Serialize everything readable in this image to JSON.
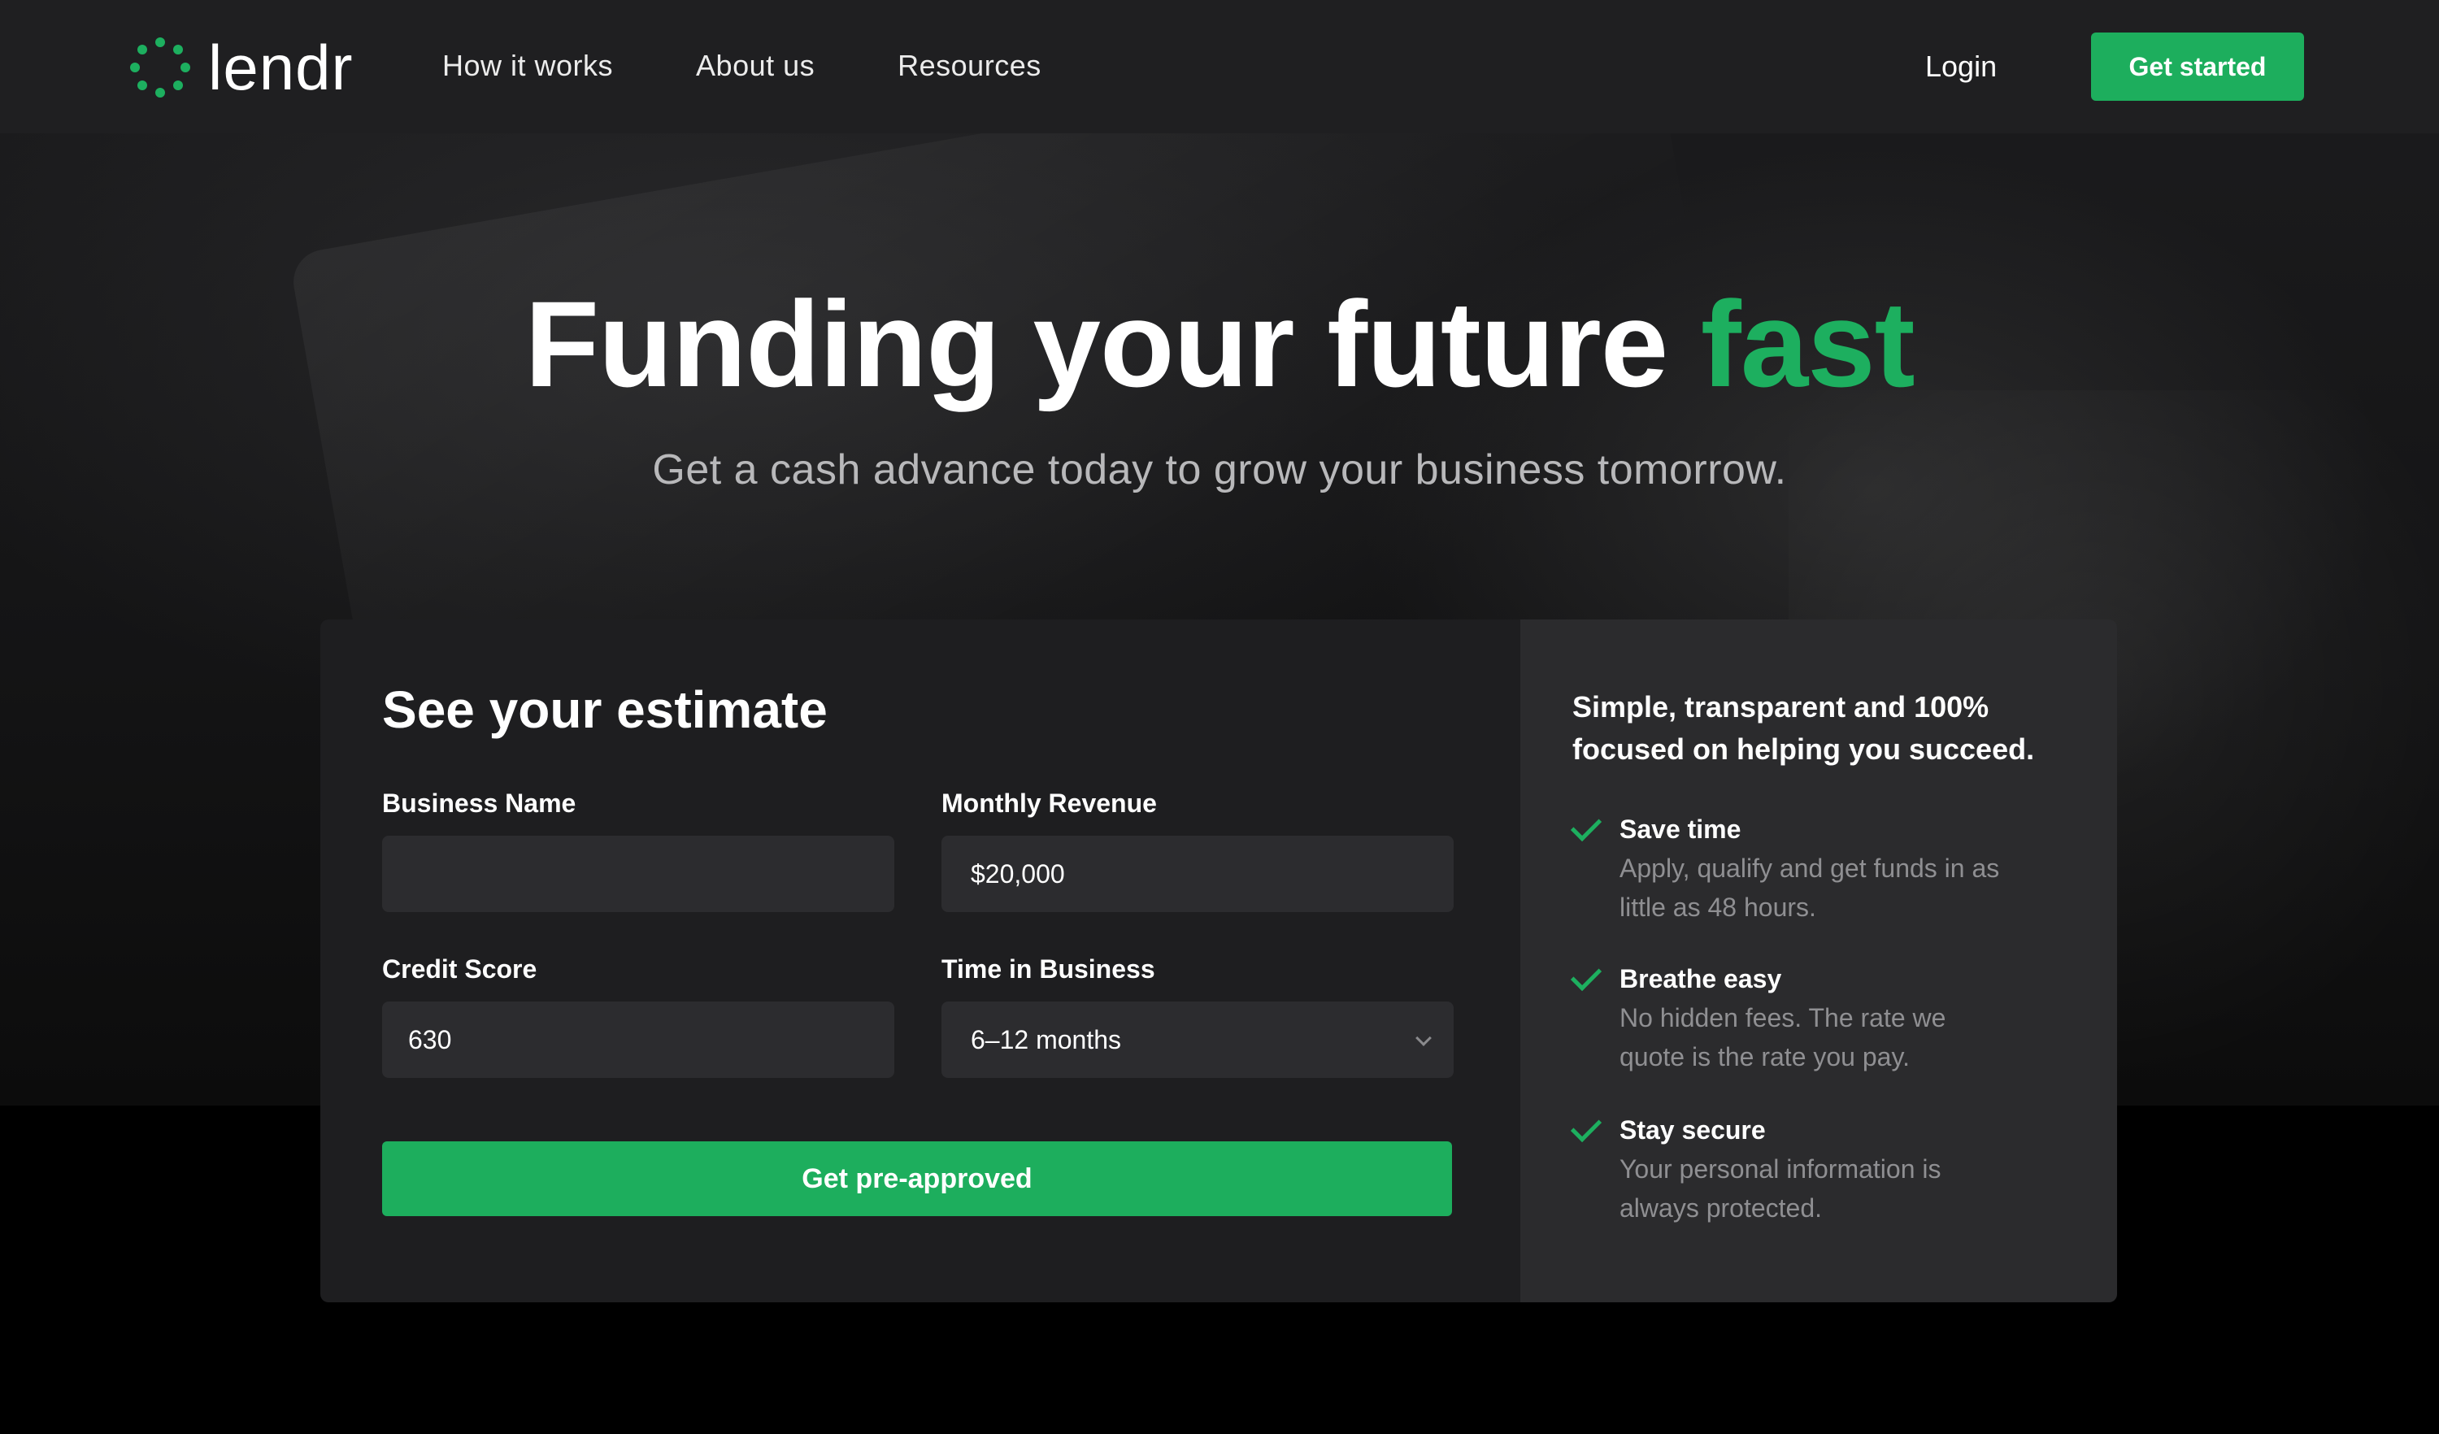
{
  "nav": {
    "logo_text": "lendr",
    "links": [
      "How it works",
      "About us",
      "Resources"
    ],
    "login": "Login",
    "get_started": "Get started"
  },
  "hero": {
    "headline_main": "Funding your future",
    "headline_accent": "fast",
    "subhead": "Get a cash advance today to grow your business tomorrow."
  },
  "estimate": {
    "title": "See your estimate",
    "business_name": {
      "label": "Business Name",
      "value": "",
      "placeholder": ""
    },
    "monthly_revenue": {
      "label": "Monthly Revenue",
      "value": "$20,000"
    },
    "credit_score": {
      "label": "Credit Score",
      "value": "630"
    },
    "time_in_business": {
      "label": "Time in Business",
      "value": "6–12 months"
    },
    "submit": "Get pre-approved"
  },
  "benefits": {
    "heading": "Simple, transparent and 100% focused on helping you succeed.",
    "items": [
      {
        "title": "Save time",
        "desc": "Apply, qualify and get funds in as little as 48 hours."
      },
      {
        "title": "Breathe easy",
        "desc": "No hidden fees. The rate we quote is the rate you pay."
      },
      {
        "title": "Stay secure",
        "desc": "Your personal information is always protected."
      }
    ]
  },
  "colors": {
    "accent": "#1daf5f",
    "nav_bg": "#1f1f21",
    "card_left_bg": "#1e1e20",
    "card_right_bg": "#2b2b2d"
  },
  "icons": [
    "logo-dots-icon",
    "check-icon",
    "chevron-down-icon"
  ]
}
